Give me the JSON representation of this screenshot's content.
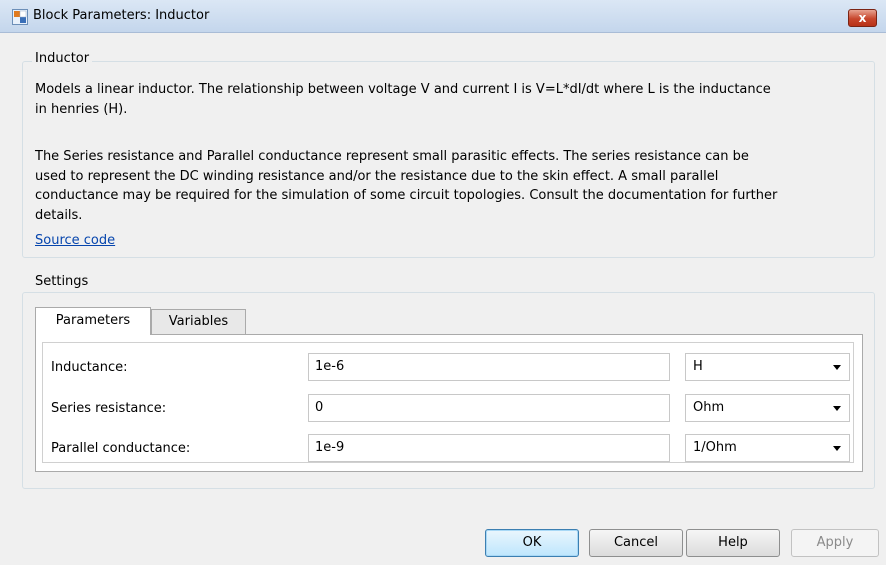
{
  "window": {
    "title": "Block Parameters: Inductor",
    "close_label": "x"
  },
  "description_group": {
    "label": "Inductor",
    "paragraph1": [
      "Models a linear inductor. The relationship between voltage V and current I is V=L*dI/dt where L is the inductance",
      "in henries (H)."
    ],
    "paragraph2": [
      "The Series resistance and Parallel conductance represent small parasitic effects. The series resistance can be",
      "used to represent the DC winding resistance and/or the resistance due to the skin effect. A small parallel",
      "conductance may be required for the simulation of some circuit topologies. Consult the documentation for further",
      "details."
    ],
    "source_link": "Source code"
  },
  "settings": {
    "label": "Settings",
    "tabs": [
      {
        "label": "Parameters",
        "active": true
      },
      {
        "label": "Variables",
        "active": false
      }
    ],
    "parameters": [
      {
        "label": "Inductance:",
        "value": "1e-6",
        "unit": "H"
      },
      {
        "label": "Series resistance:",
        "value": "0",
        "unit": "Ohm"
      },
      {
        "label": "Parallel conductance:",
        "value": "1e-9",
        "unit": "1/Ohm"
      }
    ]
  },
  "buttons": {
    "ok": "OK",
    "cancel": "Cancel",
    "help": "Help",
    "apply": "Apply"
  },
  "colors": {
    "link": "#0645ad",
    "close_button": "#c7462c",
    "default_button": "#bee6fd"
  },
  "icons": {
    "app": "simulink-block-icon",
    "close": "close-icon",
    "dropdown": "chevron-down-icon"
  }
}
